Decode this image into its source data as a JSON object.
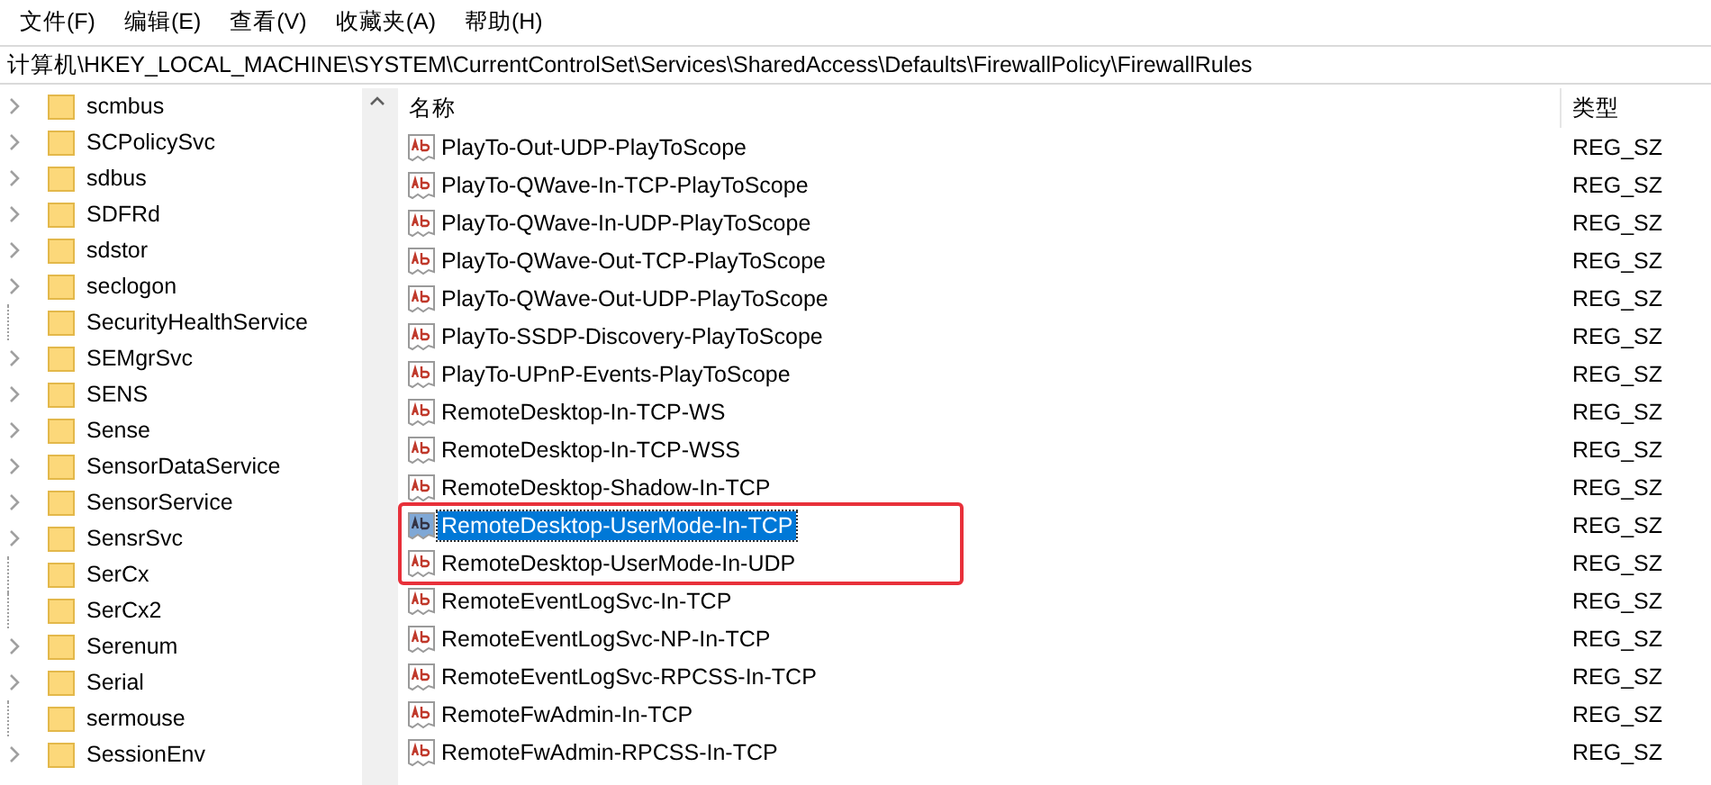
{
  "menu": [
    "文件(F)",
    "编辑(E)",
    "查看(V)",
    "收藏夹(A)",
    "帮助(H)"
  ],
  "address": "计算机\\HKEY_LOCAL_MACHINE\\SYSTEM\\CurrentControlSet\\Services\\SharedAccess\\Defaults\\FirewallPolicy\\FirewallRules",
  "tree": [
    {
      "name": "scmbus",
      "expandable": true
    },
    {
      "name": "SCPolicySvc",
      "expandable": true
    },
    {
      "name": "sdbus",
      "expandable": true
    },
    {
      "name": "SDFRd",
      "expandable": true
    },
    {
      "name": "sdstor",
      "expandable": true
    },
    {
      "name": "seclogon",
      "expandable": true
    },
    {
      "name": "SecurityHealthService",
      "expandable": false
    },
    {
      "name": "SEMgrSvc",
      "expandable": true
    },
    {
      "name": "SENS",
      "expandable": true
    },
    {
      "name": "Sense",
      "expandable": true
    },
    {
      "name": "SensorDataService",
      "expandable": true
    },
    {
      "name": "SensorService",
      "expandable": true
    },
    {
      "name": "SensrSvc",
      "expandable": true
    },
    {
      "name": "SerCx",
      "expandable": false
    },
    {
      "name": "SerCx2",
      "expandable": false
    },
    {
      "name": "Serenum",
      "expandable": true
    },
    {
      "name": "Serial",
      "expandable": true
    },
    {
      "name": "sermouse",
      "expandable": false
    },
    {
      "name": "SessionEnv",
      "expandable": true
    }
  ],
  "table": {
    "columns": [
      "名称",
      "类型"
    ],
    "rows": [
      {
        "name": "PlayTo-Out-UDP-PlayToScope",
        "type": "REG_SZ",
        "selected": false,
        "annotated": false
      },
      {
        "name": "PlayTo-QWave-In-TCP-PlayToScope",
        "type": "REG_SZ",
        "selected": false,
        "annotated": false
      },
      {
        "name": "PlayTo-QWave-In-UDP-PlayToScope",
        "type": "REG_SZ",
        "selected": false,
        "annotated": false
      },
      {
        "name": "PlayTo-QWave-Out-TCP-PlayToScope",
        "type": "REG_SZ",
        "selected": false,
        "annotated": false
      },
      {
        "name": "PlayTo-QWave-Out-UDP-PlayToScope",
        "type": "REG_SZ",
        "selected": false,
        "annotated": false
      },
      {
        "name": "PlayTo-SSDP-Discovery-PlayToScope",
        "type": "REG_SZ",
        "selected": false,
        "annotated": false
      },
      {
        "name": "PlayTo-UPnP-Events-PlayToScope",
        "type": "REG_SZ",
        "selected": false,
        "annotated": false
      },
      {
        "name": "RemoteDesktop-In-TCP-WS",
        "type": "REG_SZ",
        "selected": false,
        "annotated": false
      },
      {
        "name": "RemoteDesktop-In-TCP-WSS",
        "type": "REG_SZ",
        "selected": false,
        "annotated": false
      },
      {
        "name": "RemoteDesktop-Shadow-In-TCP",
        "type": "REG_SZ",
        "selected": false,
        "annotated": false
      },
      {
        "name": "RemoteDesktop-UserMode-In-TCP",
        "type": "REG_SZ",
        "selected": true,
        "annotated": true
      },
      {
        "name": "RemoteDesktop-UserMode-In-UDP",
        "type": "REG_SZ",
        "selected": false,
        "annotated": true
      },
      {
        "name": "RemoteEventLogSvc-In-TCP",
        "type": "REG_SZ",
        "selected": false,
        "annotated": false
      },
      {
        "name": "RemoteEventLogSvc-NP-In-TCP",
        "type": "REG_SZ",
        "selected": false,
        "annotated": false
      },
      {
        "name": "RemoteEventLogSvc-RPCSS-In-TCP",
        "type": "REG_SZ",
        "selected": false,
        "annotated": false
      },
      {
        "name": "RemoteFwAdmin-In-TCP",
        "type": "REG_SZ",
        "selected": false,
        "annotated": false
      },
      {
        "name": "RemoteFwAdmin-RPCSS-In-TCP",
        "type": "REG_SZ",
        "selected": false,
        "annotated": false
      }
    ]
  }
}
